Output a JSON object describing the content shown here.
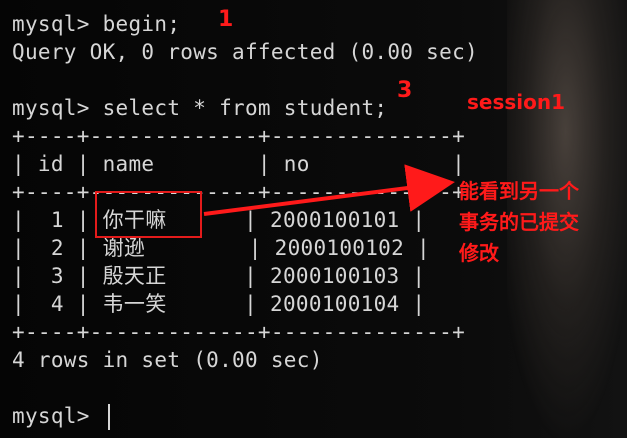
{
  "terminal": {
    "lines": [
      "mysql> begin;",
      "Query OK, 0 rows affected (0.00 sec)",
      "",
      "mysql> select * from student;",
      "+----+-------------+--------------+",
      "| id | name        | no           |",
      "+----+-------------+--------------+",
      "|  1 | 你干嘛      | 2000100101 |",
      "|  2 | 谢逊        | 2000100102 |",
      "|  3 | 殷天正      | 2000100103 |",
      "|  4 | 韦一笑      | 2000100104 |",
      "+----+-------------+--------------+",
      "4 rows in set (0.00 sec)",
      "",
      "mysql> "
    ]
  },
  "annotations": {
    "step1": "1",
    "step3": "3",
    "session": "session1",
    "note_lines": [
      "能看到另一个",
      "事务的已提交",
      "修改"
    ]
  },
  "colors": {
    "annotation": "#ff1a1a",
    "terminal_text": "#d6d6d6",
    "background": "#0b0b0b"
  }
}
